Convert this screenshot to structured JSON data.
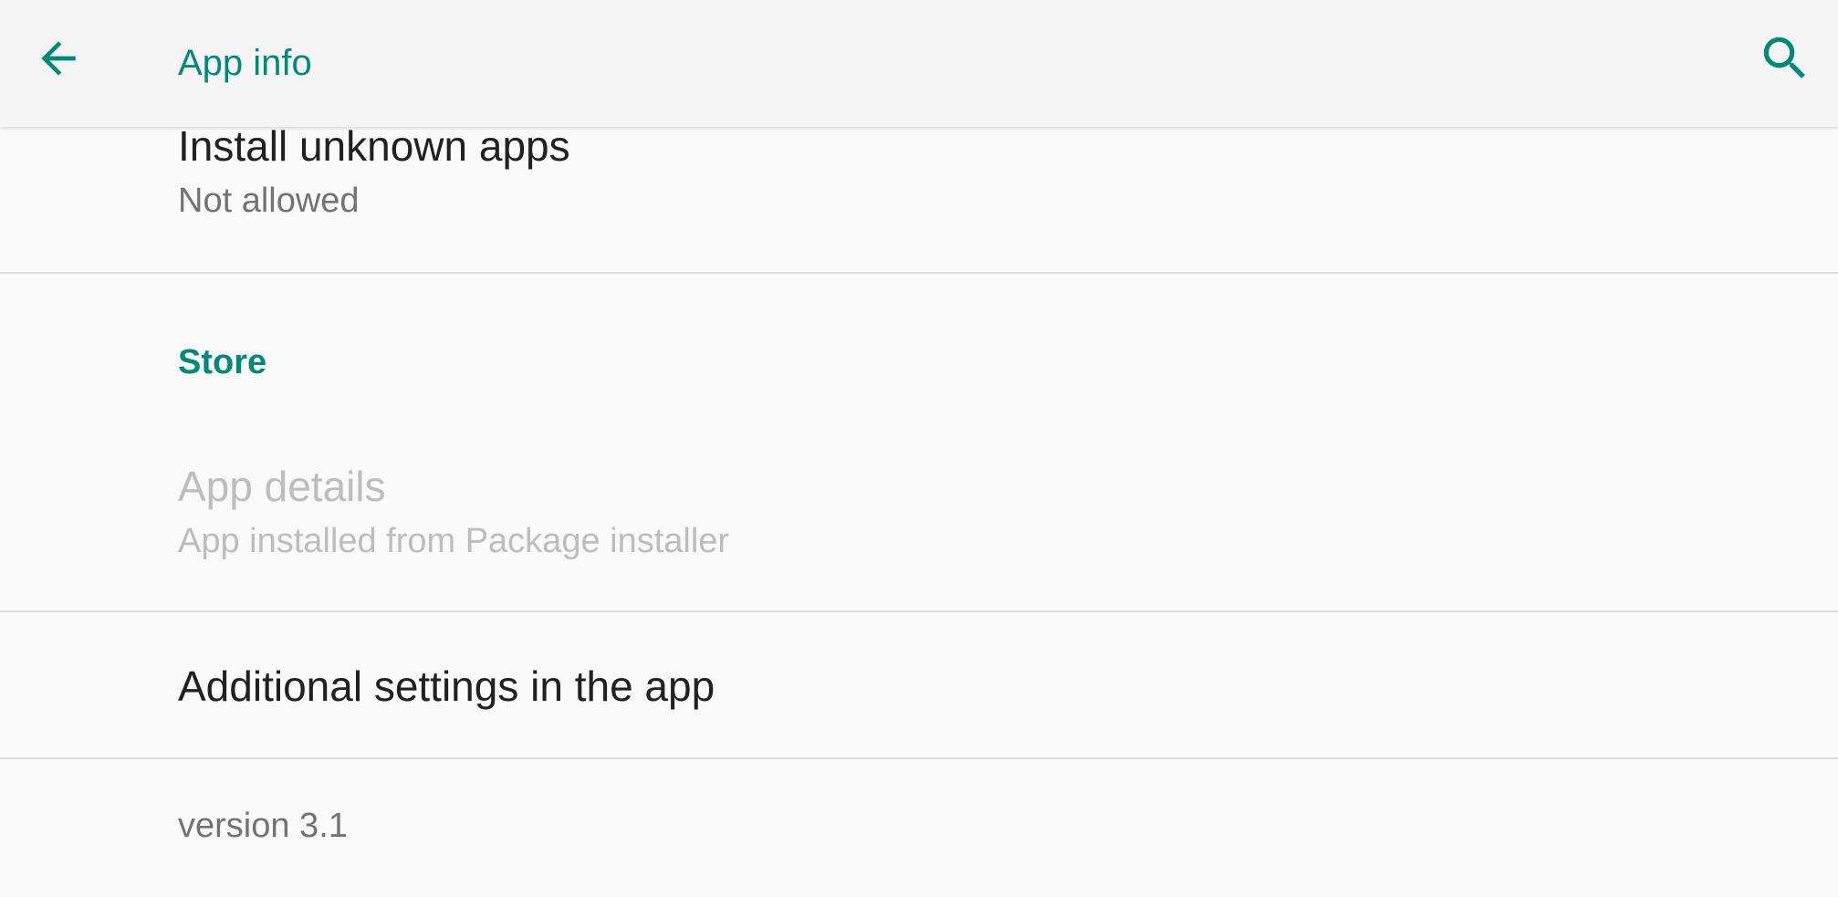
{
  "appbar": {
    "title": "App info",
    "accent_color": "#00897b",
    "back_icon": "arrow-back-icon",
    "search_icon": "search-icon"
  },
  "install_unknown": {
    "title": "Install unknown apps",
    "summary": "Not allowed"
  },
  "store": {
    "header": "Store",
    "app_details": {
      "title": "App details",
      "summary": "App installed from Package installer",
      "enabled": false
    }
  },
  "additional_settings": {
    "title": "Additional settings in the app"
  },
  "footer": {
    "version": "version 3.1"
  }
}
